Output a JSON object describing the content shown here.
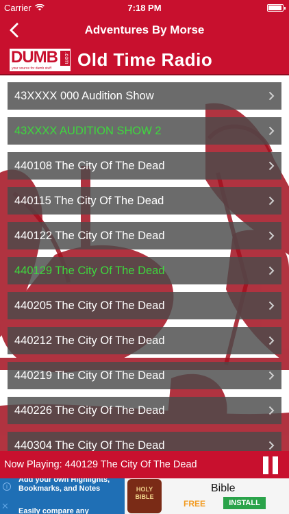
{
  "status_bar": {
    "carrier": "Carrier",
    "time": "7:18 PM"
  },
  "nav": {
    "title": "Adventures By Morse",
    "back_icon": "chevron-left-icon"
  },
  "banner": {
    "logo_text": "DUMB",
    "logo_suffix": ".com",
    "logo_tagline": "your source for dumb stuff",
    "title": "Old Time Radio"
  },
  "episodes": [
    {
      "label": "43XXXX 000 Audition Show",
      "playing": false
    },
    {
      "label": "43XXXX AUDITION SHOW 2",
      "playing": true
    },
    {
      "label": "440108 The City Of The Dead",
      "playing": false
    },
    {
      "label": "440115 The City Of The Dead",
      "playing": false
    },
    {
      "label": "440122 The City Of The Dead",
      "playing": false
    },
    {
      "label": "440129 The City Of The Dead",
      "playing": true
    },
    {
      "label": "440205 The City Of The Dead",
      "playing": false
    },
    {
      "label": "440212 The City Of The Dead",
      "playing": false
    },
    {
      "label": "440219 The City Of The Dead",
      "playing": false
    },
    {
      "label": "440226 The City Of The Dead",
      "playing": false
    },
    {
      "label": "440304 The City Of The Dead",
      "playing": false
    }
  ],
  "now_playing": {
    "text": "Now Playing: 440129 The City Of The Dead"
  },
  "ad": {
    "line1": "Add your own Highlights,",
    "line2": "Bookmarks, and Notes",
    "line3": "Easily compare any",
    "book_text": "HOLY BIBLE",
    "title": "Bible",
    "price": "FREE",
    "install_label": "INSTALL"
  },
  "colors": {
    "brand_red": "#c8102e",
    "row_gray": "#4a4a4a",
    "playing_green": "#3ed83e"
  }
}
